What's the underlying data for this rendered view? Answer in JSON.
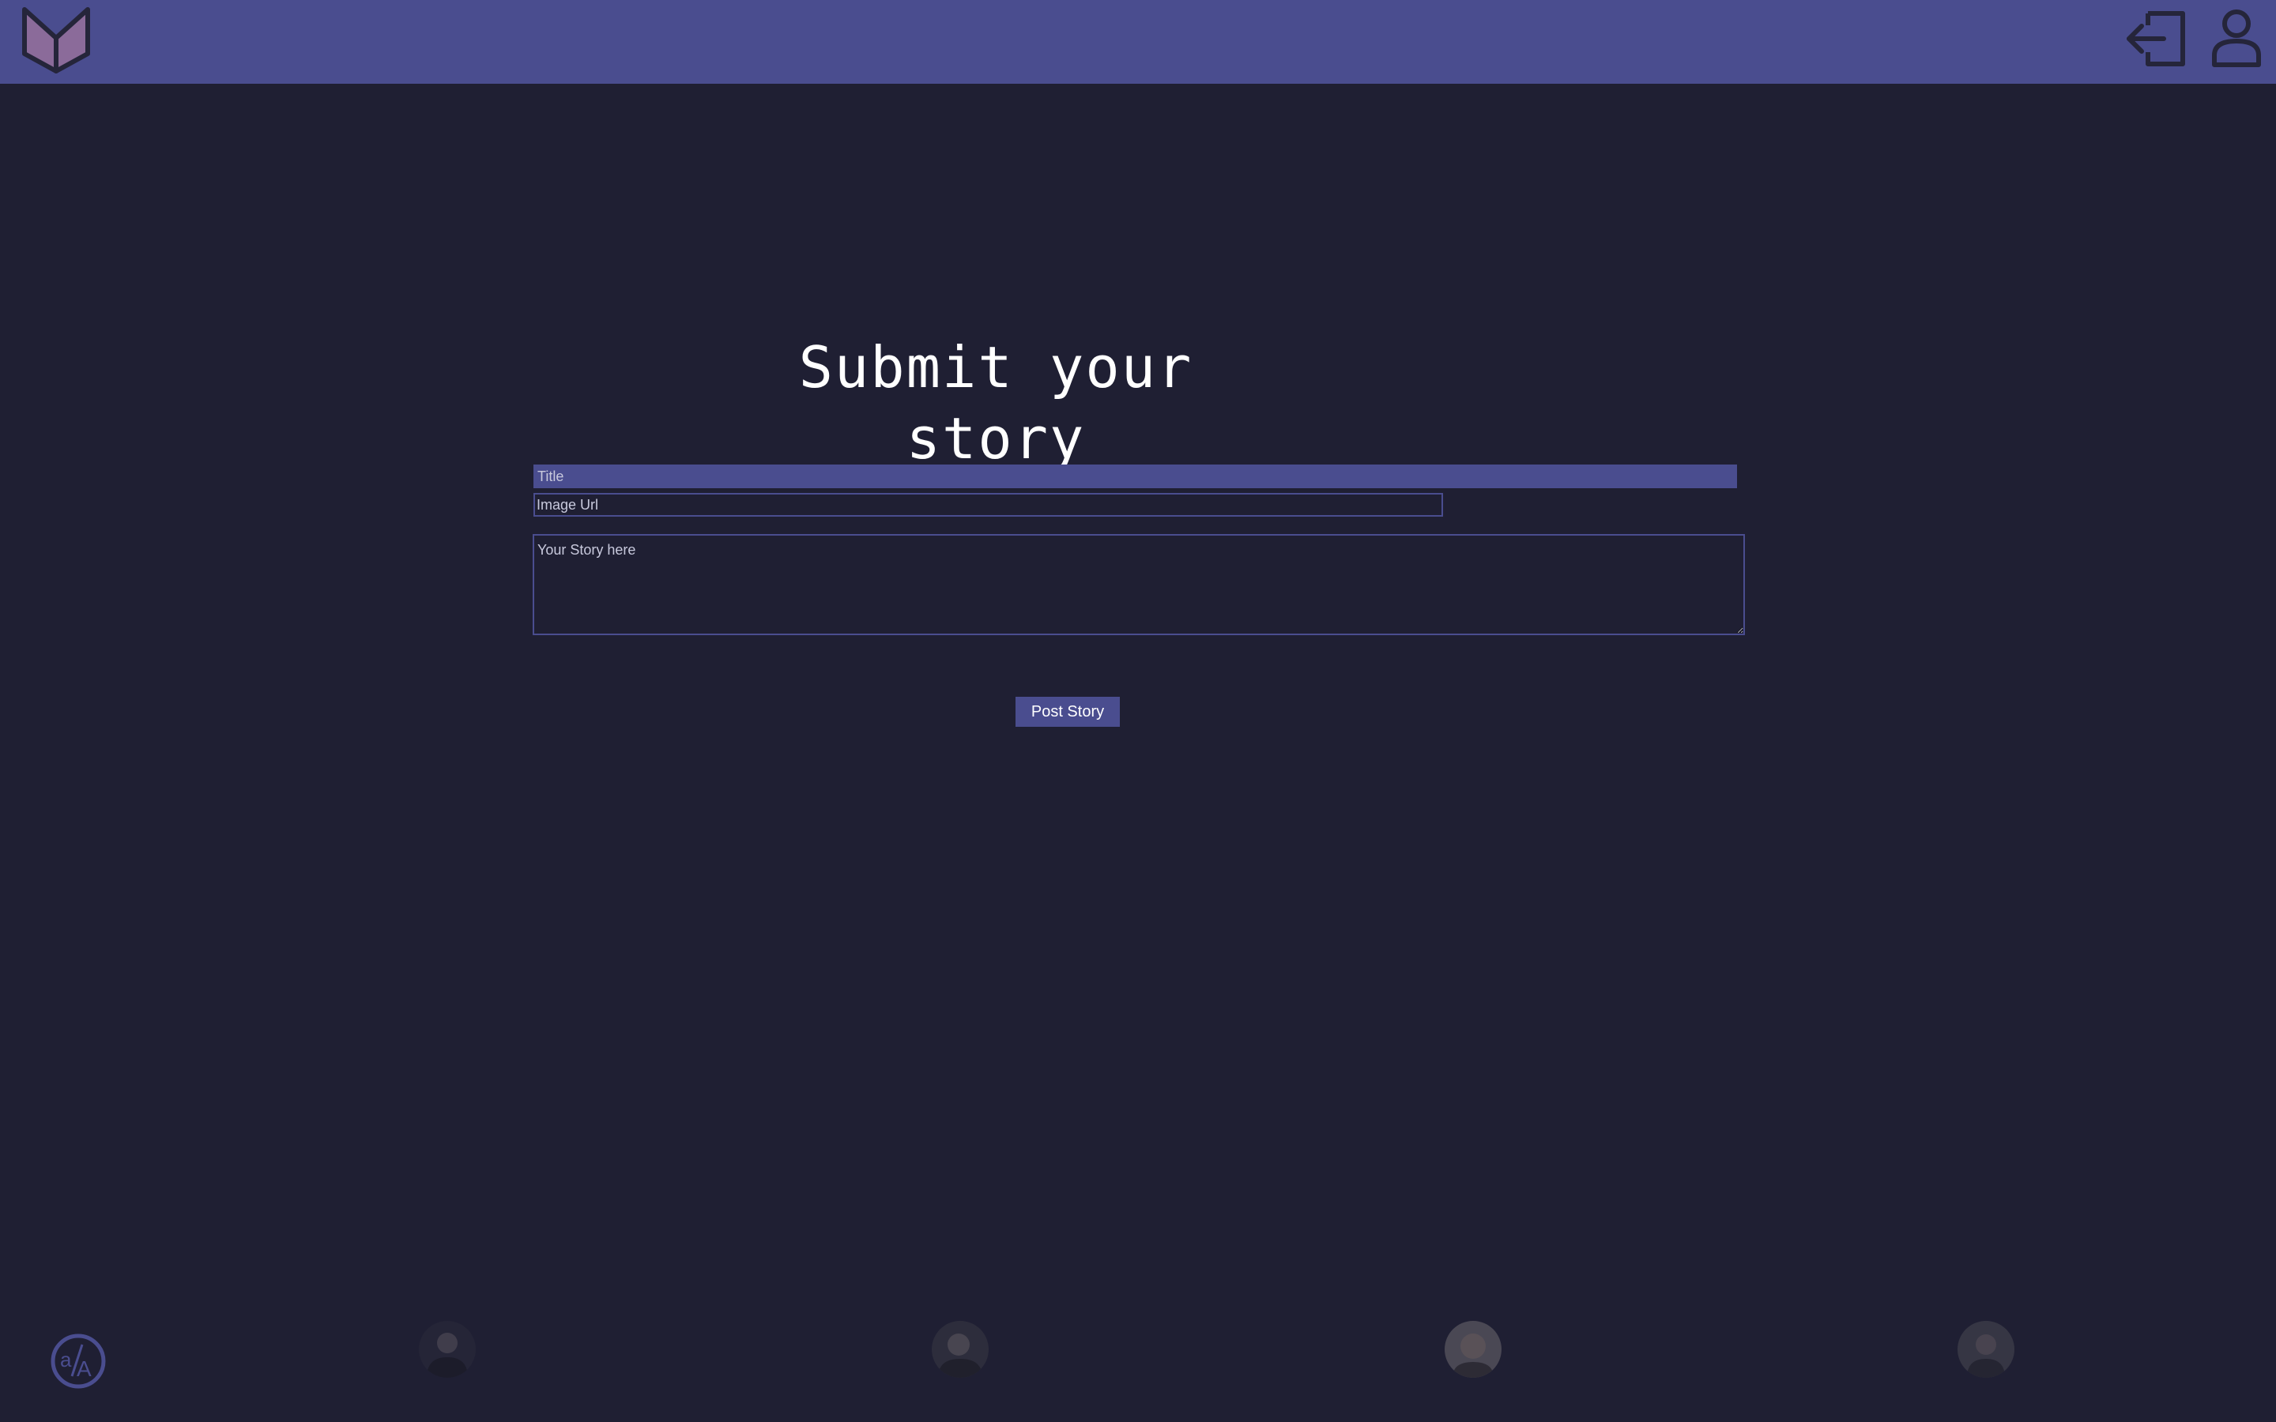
{
  "header": {
    "logo_icon": "book-icon",
    "logout_icon": "logout-icon",
    "profile_icon": "user-icon"
  },
  "main": {
    "title": "Submit your story",
    "form": {
      "title_placeholder": "Title",
      "image_url_placeholder": "Image Url",
      "story_placeholder": "Your Story here",
      "submit_label": "Post Story"
    }
  },
  "footer": {
    "logo_icon": "aa-logo-icon",
    "avatars": [
      "avatar-1",
      "avatar-2",
      "avatar-3",
      "avatar-4"
    ]
  },
  "colors": {
    "background": "#1f1f33",
    "accent": "#4a4d8f",
    "logo_fill": "#8b6b9a",
    "icon_dark": "#25253a"
  }
}
